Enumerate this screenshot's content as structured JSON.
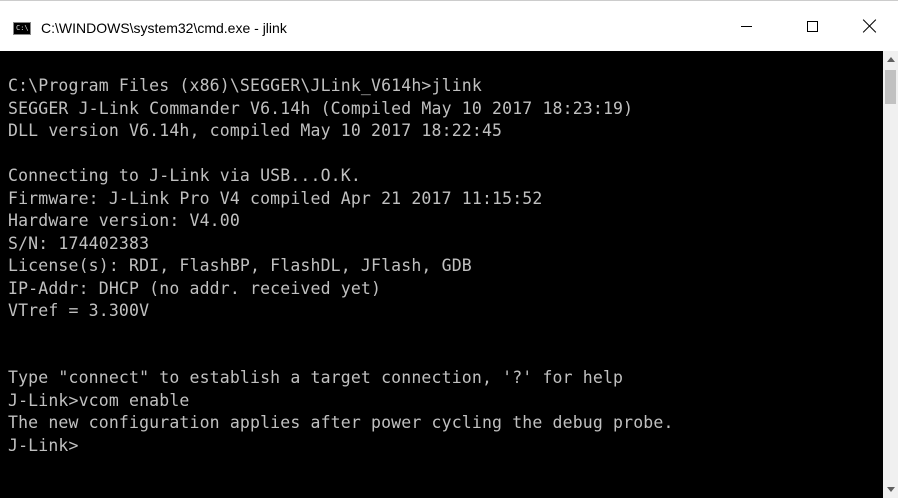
{
  "window": {
    "title": "C:\\WINDOWS\\system32\\cmd.exe - jlink",
    "icon_name": "cmd-icon",
    "icon_text": "C:\\",
    "controls": [
      "minimize-icon",
      "maximize-icon",
      "close-icon"
    ]
  },
  "console": {
    "text_color": "#c0c0c0",
    "background": "#000000",
    "lines": [
      "",
      "C:\\Program Files (x86)\\SEGGER\\JLink_V614h>jlink",
      "SEGGER J-Link Commander V6.14h (Compiled May 10 2017 18:23:19)",
      "DLL version V6.14h, compiled May 10 2017 18:22:45",
      "",
      "Connecting to J-Link via USB...O.K.",
      "Firmware: J-Link Pro V4 compiled Apr 21 2017 11:15:52",
      "Hardware version: V4.00",
      "S/N: 174402383",
      "License(s): RDI, FlashBP, FlashDL, JFlash, GDB",
      "IP-Addr: DHCP (no addr. received yet)",
      "VTref = 3.300V",
      "",
      "",
      "Type \"connect\" to establish a target connection, '?' for help",
      "J-Link>vcom enable",
      "The new configuration applies after power cycling the debug probe.",
      "J-Link>"
    ]
  }
}
